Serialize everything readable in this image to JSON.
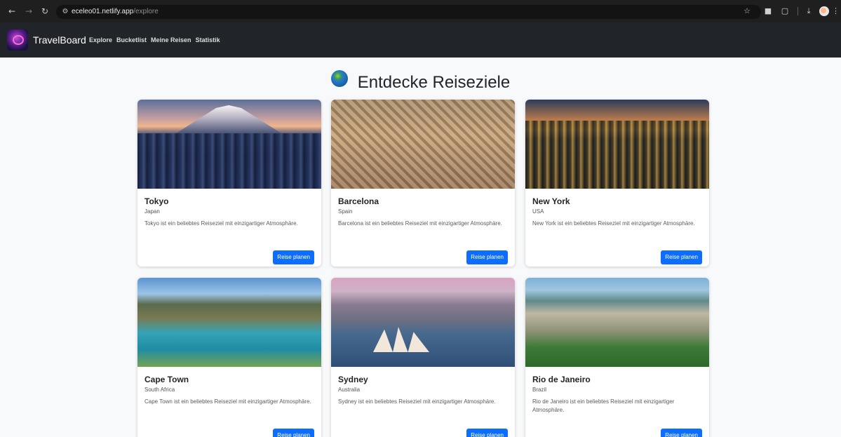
{
  "browser": {
    "url_host": "eceleo01.netlify.app",
    "url_path": "/explore"
  },
  "navbar": {
    "brand": "TravelBoard",
    "links": [
      "Explore",
      "Bucketlist",
      "Meine Reisen",
      "Statistik"
    ]
  },
  "page": {
    "title": "Entdecke Reiseziele"
  },
  "destinations": [
    {
      "name": "Tokyo",
      "country": "Japan",
      "description": "Tokyo ist ein beliebtes Reiseziel mit einzigartiger Atmosphäre.",
      "button": "Reise planen"
    },
    {
      "name": "Barcelona",
      "country": "Spain",
      "description": "Barcelona ist ein beliebtes Reiseziel mit einzigartiger Atmosphäre.",
      "button": "Reise planen"
    },
    {
      "name": "New York",
      "country": "USA",
      "description": "New York ist ein beliebtes Reiseziel mit einzigartiger Atmosphäre.",
      "button": "Reise planen"
    },
    {
      "name": "Cape Town",
      "country": "South Africa",
      "description": "Cape Town ist ein beliebtes Reiseziel mit einzigartiger Atmosphäre.",
      "button": "Reise planen"
    },
    {
      "name": "Sydney",
      "country": "Australia",
      "description": "Sydney ist ein beliebtes Reiseziel mit einzigartiger Atmosphäre.",
      "button": "Reise planen"
    },
    {
      "name": "Rio de Janeiro",
      "country": "Brazil",
      "description": "Rio de Janeiro ist ein beliebtes Reiseziel mit einzigartiger Atmosphäre.",
      "button": "Reise planen"
    }
  ],
  "colors": {
    "navbar_bg": "#212529",
    "button_bg": "#0d6efd",
    "page_bg": "#f8f9fa"
  }
}
